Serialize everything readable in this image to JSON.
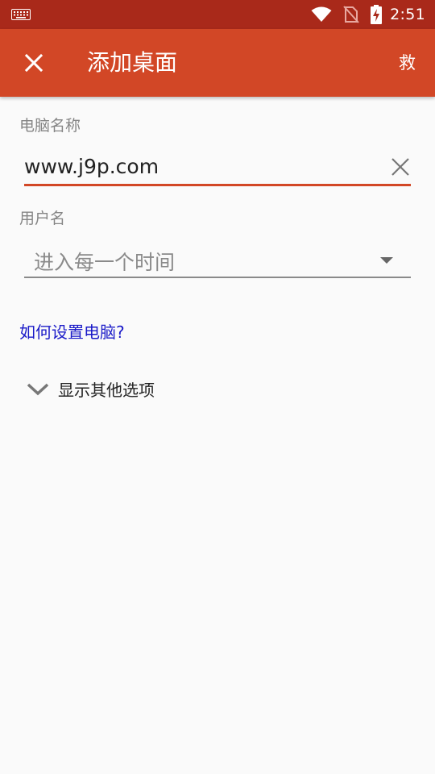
{
  "status_bar": {
    "time": "2:51",
    "icons": [
      "keyboard-icon",
      "wifi-icon",
      "no-sim-icon",
      "battery-charging-icon"
    ]
  },
  "app_bar": {
    "title": "添加桌面",
    "save_label": "救",
    "close_icon": "close-icon"
  },
  "form": {
    "pc_name": {
      "label": "电脑名称",
      "value": "www.j9p.com"
    },
    "username": {
      "label": "用户名",
      "placeholder": "进入每一个时间"
    }
  },
  "help_link": "如何设置电脑?",
  "more_options": {
    "label": "显示其他选项",
    "icon": "chevron-down-icon"
  },
  "colors": {
    "status_bar": "#a9291a",
    "app_bar": "#d24726",
    "accent": "#d24726",
    "link": "#1a1ac8"
  }
}
